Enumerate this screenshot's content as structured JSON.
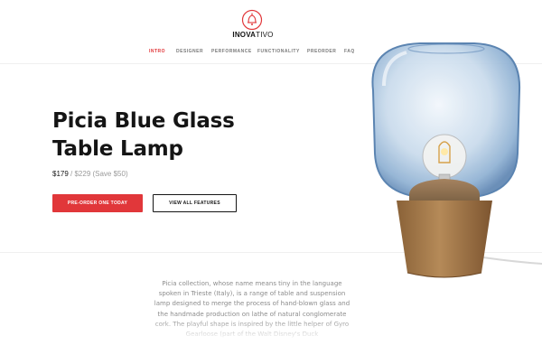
{
  "header": {
    "logo_icon": "bell-lamp-icon",
    "logo_bold": "INOVA",
    "logo_light": "TIVO",
    "nav": [
      {
        "label": "INTRO",
        "active": true
      },
      {
        "label": "DESIGNER",
        "active": false
      },
      {
        "label": "PERFORMANCE",
        "active": false
      },
      {
        "label": "FUNCTIONALITY",
        "active": false
      },
      {
        "label": "PREORDER",
        "active": false
      },
      {
        "label": "FAQ",
        "active": false
      }
    ]
  },
  "hero": {
    "title_line1": "Picia Blue Glass",
    "title_line2": "Table Lamp",
    "price_now": "$179",
    "price_rest": " / $229 (Save $50)",
    "primary_button": "PRE-ORDER ONE TODAY",
    "secondary_button": "VIEW ALL FEATURES"
  },
  "product_image": {
    "icon": "glass-table-lamp-image"
  },
  "description": {
    "text": "Picia collection, whose name means tiny in the language spoken in Trieste (Italy), is a range of table and suspension lamp designed to merge the process of hand-blown glass and the handmade production on lathe of natural conglomerate cork. The playful shape is inspired by the little helper of Gyro Gearloose (part of the Walt Disney's Duck"
  },
  "colors": {
    "accent": "#e1373a",
    "text": "#151515",
    "muted": "#8c8c8c"
  }
}
